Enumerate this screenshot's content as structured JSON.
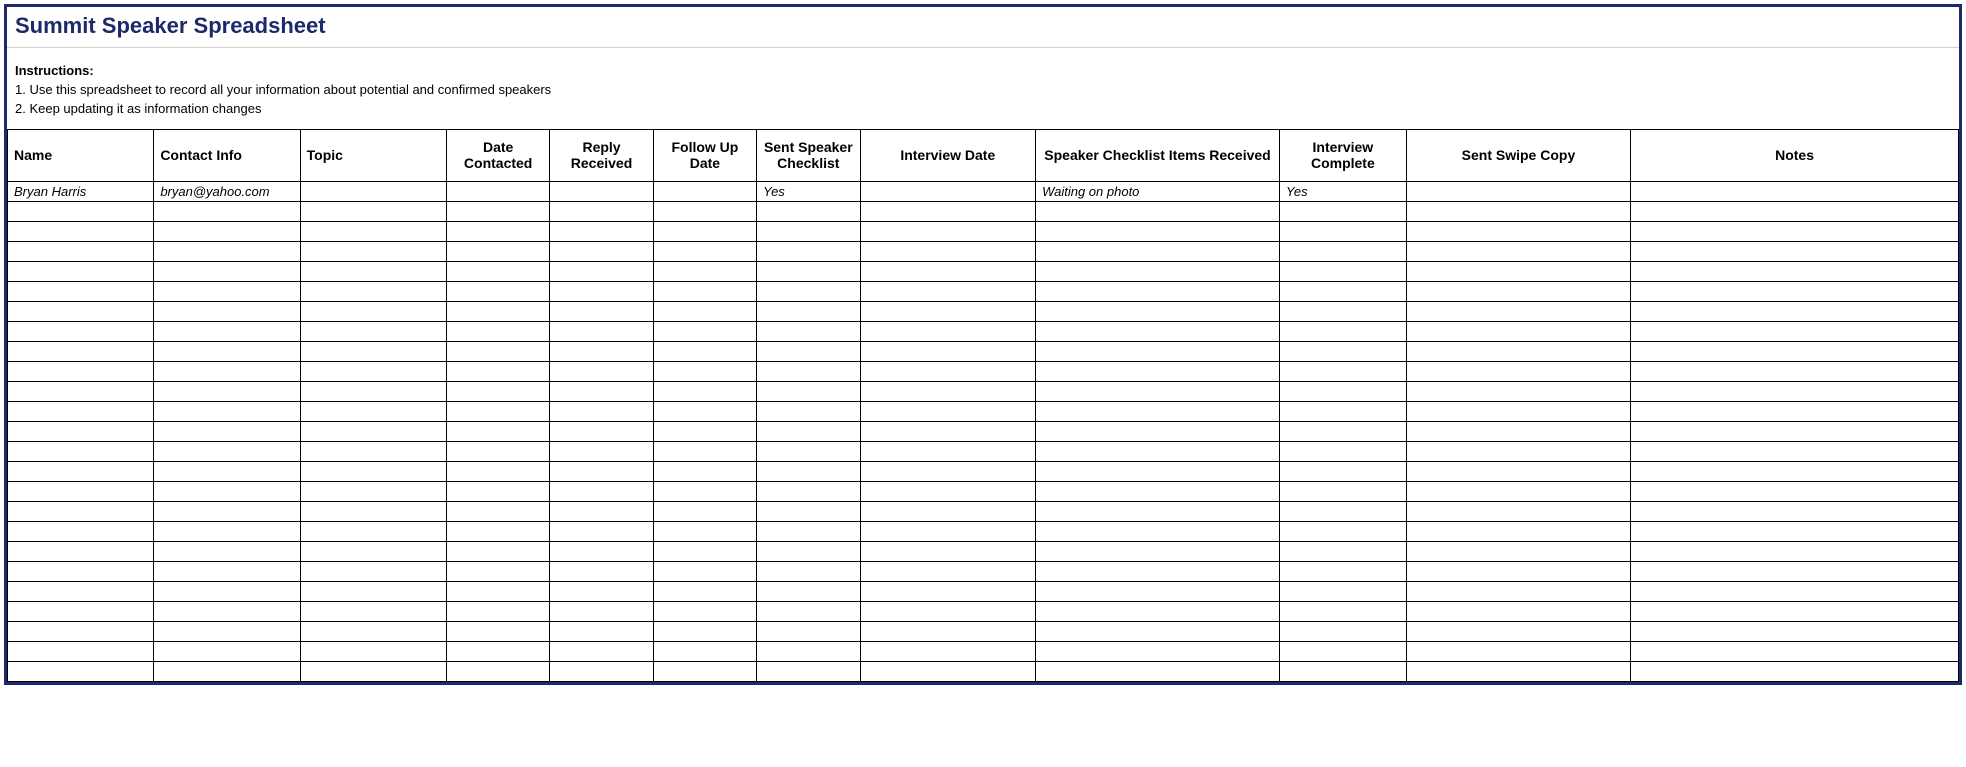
{
  "title": "Summit Speaker Spreadsheet",
  "instructions": {
    "label": "Instructions:",
    "line1": "1. Use this spreadsheet to record all your information about potential and confirmed speakers",
    "line2": "2. Keep updating it as information changes"
  },
  "columns": [
    {
      "label": "Name",
      "align": "left"
    },
    {
      "label": "Contact Info",
      "align": "left"
    },
    {
      "label": "Topic",
      "align": "left"
    },
    {
      "label": "Date Contacted",
      "align": "center"
    },
    {
      "label": "Reply Received",
      "align": "center"
    },
    {
      "label": "Follow Up Date",
      "align": "center"
    },
    {
      "label": "Sent Speaker Checklist",
      "align": "center"
    },
    {
      "label": "Interview Date",
      "align": "center"
    },
    {
      "label": "Speaker Checklist Items Received",
      "align": "center"
    },
    {
      "label": "Interview Complete",
      "align": "center"
    },
    {
      "label": "Sent Swipe Copy",
      "align": "center"
    },
    {
      "label": "Notes",
      "align": "center"
    }
  ],
  "rows": [
    [
      "Bryan Harris",
      "bryan@yahoo.com",
      "",
      "",
      "",
      "",
      "Yes",
      "",
      "Waiting on photo",
      "Yes",
      "",
      ""
    ],
    [
      "",
      "",
      "",
      "",
      "",
      "",
      "",
      "",
      "",
      "",
      "",
      ""
    ],
    [
      "",
      "",
      "",
      "",
      "",
      "",
      "",
      "",
      "",
      "",
      "",
      ""
    ],
    [
      "",
      "",
      "",
      "",
      "",
      "",
      "",
      "",
      "",
      "",
      "",
      ""
    ],
    [
      "",
      "",
      "",
      "",
      "",
      "",
      "",
      "",
      "",
      "",
      "",
      ""
    ],
    [
      "",
      "",
      "",
      "",
      "",
      "",
      "",
      "",
      "",
      "",
      "",
      ""
    ],
    [
      "",
      "",
      "",
      "",
      "",
      "",
      "",
      "",
      "",
      "",
      "",
      ""
    ],
    [
      "",
      "",
      "",
      "",
      "",
      "",
      "",
      "",
      "",
      "",
      "",
      ""
    ],
    [
      "",
      "",
      "",
      "",
      "",
      "",
      "",
      "",
      "",
      "",
      "",
      ""
    ],
    [
      "",
      "",
      "",
      "",
      "",
      "",
      "",
      "",
      "",
      "",
      "",
      ""
    ],
    [
      "",
      "",
      "",
      "",
      "",
      "",
      "",
      "",
      "",
      "",
      "",
      ""
    ],
    [
      "",
      "",
      "",
      "",
      "",
      "",
      "",
      "",
      "",
      "",
      "",
      ""
    ],
    [
      "",
      "",
      "",
      "",
      "",
      "",
      "",
      "",
      "",
      "",
      "",
      ""
    ],
    [
      "",
      "",
      "",
      "",
      "",
      "",
      "",
      "",
      "",
      "",
      "",
      ""
    ],
    [
      "",
      "",
      "",
      "",
      "",
      "",
      "",
      "",
      "",
      "",
      "",
      ""
    ],
    [
      "",
      "",
      "",
      "",
      "",
      "",
      "",
      "",
      "",
      "",
      "",
      ""
    ],
    [
      "",
      "",
      "",
      "",
      "",
      "",
      "",
      "",
      "",
      "",
      "",
      ""
    ],
    [
      "",
      "",
      "",
      "",
      "",
      "",
      "",
      "",
      "",
      "",
      "",
      ""
    ],
    [
      "",
      "",
      "",
      "",
      "",
      "",
      "",
      "",
      "",
      "",
      "",
      ""
    ],
    [
      "",
      "",
      "",
      "",
      "",
      "",
      "",
      "",
      "",
      "",
      "",
      ""
    ],
    [
      "",
      "",
      "",
      "",
      "",
      "",
      "",
      "",
      "",
      "",
      "",
      ""
    ],
    [
      "",
      "",
      "",
      "",
      "",
      "",
      "",
      "",
      "",
      "",
      "",
      ""
    ],
    [
      "",
      "",
      "",
      "",
      "",
      "",
      "",
      "",
      "",
      "",
      "",
      ""
    ],
    [
      "",
      "",
      "",
      "",
      "",
      "",
      "",
      "",
      "",
      "",
      "",
      ""
    ],
    [
      "",
      "",
      "",
      "",
      "",
      "",
      "",
      "",
      "",
      "",
      "",
      ""
    ]
  ]
}
